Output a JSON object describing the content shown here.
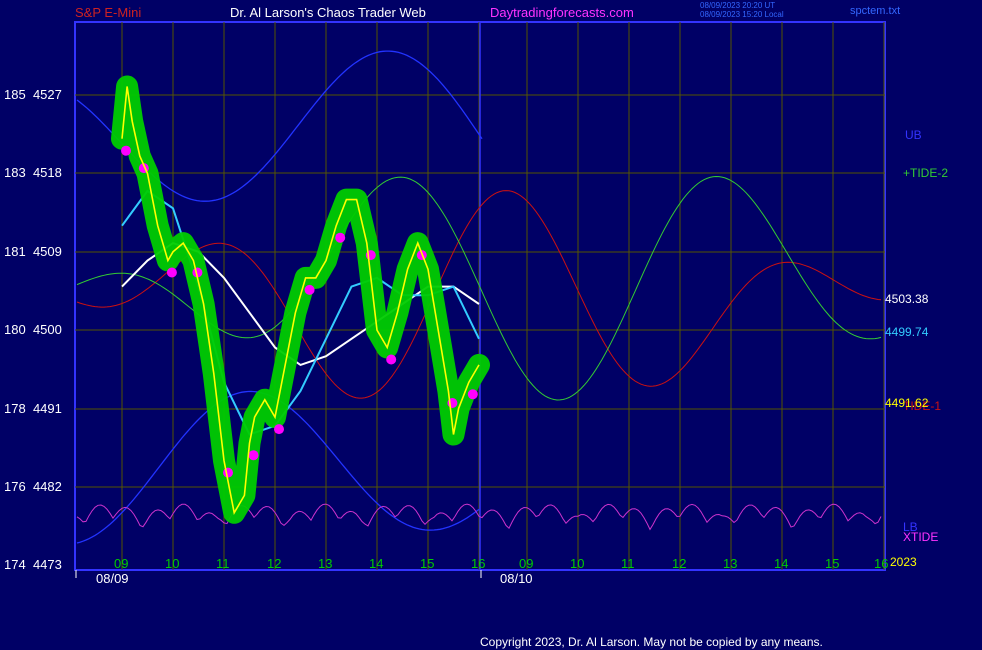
{
  "header": {
    "symbol": "S&P E-Mini",
    "author": "Dr. Al Larson's Chaos Trader Web",
    "site": "Daytradingforecasts.com",
    "timestamp1": "08/09/2023 20:20 UT",
    "timestamp2": "08/09/2023 15:20 Local",
    "filename": "spctem.txt"
  },
  "y_labels": [
    {
      "left": "185",
      "right": "4527"
    },
    {
      "left": "183",
      "right": "4518"
    },
    {
      "left": "181",
      "right": "4509"
    },
    {
      "left": "180",
      "right": "4500"
    },
    {
      "left": "178",
      "right": "4491"
    },
    {
      "left": "176",
      "right": "4482"
    },
    {
      "left": "174",
      "right": "4473"
    }
  ],
  "right_labels": {
    "ub": "UB",
    "tide2": "+TIDE-2",
    "value_white": "4503.38",
    "value_cyan": "4499.74",
    "value_yellow": "4491.62",
    "tide1": "TIDE-1",
    "lb": "LB",
    "xtide": "XTIDE",
    "year": "2023"
  },
  "x_labels": [
    "09",
    "10",
    "11",
    "12",
    "13",
    "14",
    "15",
    "16",
    "09",
    "10",
    "11",
    "12",
    "13",
    "14",
    "15",
    "16"
  ],
  "date_labels": [
    "08/09",
    "08/10"
  ],
  "copyright": "Copyright 2023, Dr. Al Larson. May not be copied by any means.",
  "colors": {
    "background": "#000066",
    "frame": "#3333ff",
    "grid": "#555500",
    "price": "#ffff00",
    "price_glow": "#00cc00",
    "highlight_dots": "#ff00ff",
    "ma_white": "#ffffff",
    "ma_cyan": "#33ccff",
    "upper_band": "#2233ff",
    "tide1": "#cc1111",
    "tide2": "#33cc33",
    "xtide": "#cc33cc"
  },
  "chart_data": {
    "type": "line",
    "title": "S&P E-Mini",
    "x_axis": "time of day (hours), 08/09 to 08/10",
    "y_axis_left": "ETF scale",
    "y_axis_right": "S&P price",
    "ylim": [
      4473,
      4534
    ],
    "series": [
      {
        "name": "price",
        "x": [
          9.0,
          9.1,
          9.2,
          9.35,
          9.5,
          9.7,
          9.9,
          10.0,
          10.2,
          10.4,
          10.6,
          10.8,
          11.0,
          11.2,
          11.4,
          11.5,
          11.6,
          11.8,
          12.0,
          12.2,
          12.4,
          12.6,
          12.8,
          13.0,
          13.2,
          13.4,
          13.6,
          13.8,
          13.9,
          14.0,
          14.2,
          14.4,
          14.6,
          14.8,
          15.0,
          15.2,
          15.4,
          15.5,
          15.6,
          15.8,
          16.0
        ],
        "values": [
          4522,
          4528,
          4524,
          4520,
          4518,
          4512,
          4508,
          4509,
          4510,
          4508,
          4503,
          4495,
          4485,
          4479,
          4481,
          4487,
          4490,
          4492,
          4490,
          4496,
          4502,
          4506,
          4506,
          4508,
          4512,
          4515,
          4515,
          4510,
          4505,
          4500,
          4498,
          4502,
          4507,
          4510,
          4507,
          4500,
          4493,
          4488,
          4491,
          4494,
          4496
        ]
      },
      {
        "name": "white moving average",
        "x": [
          9.0,
          9.5,
          10.0,
          10.5,
          11.0,
          11.5,
          12.0,
          12.5,
          13.0,
          13.5,
          14.0,
          14.5,
          15.0,
          15.5,
          16.0
        ],
        "values": [
          4505,
          4508,
          4510,
          4509,
          4506,
          4502,
          4498,
          4496,
          4497,
          4499,
          4501,
          4503,
          4505,
          4505,
          4503
        ]
      },
      {
        "name": "cyan moving average",
        "x": [
          9.0,
          9.5,
          10.0,
          10.5,
          11.0,
          11.5,
          12.0,
          12.5,
          13.0,
          13.5,
          14.0,
          14.5,
          15.0,
          15.5,
          16.0
        ],
        "values": [
          4512,
          4516,
          4514,
          4505,
          4494,
          4488,
          4489,
          4493,
          4499,
          4505,
          4506,
          4504,
          4504,
          4505,
          4499
        ]
      },
      {
        "name": "UB"
      },
      {
        "name": "TIDE-1"
      },
      {
        "name": "TIDE-2"
      },
      {
        "name": "XTIDE"
      }
    ]
  }
}
